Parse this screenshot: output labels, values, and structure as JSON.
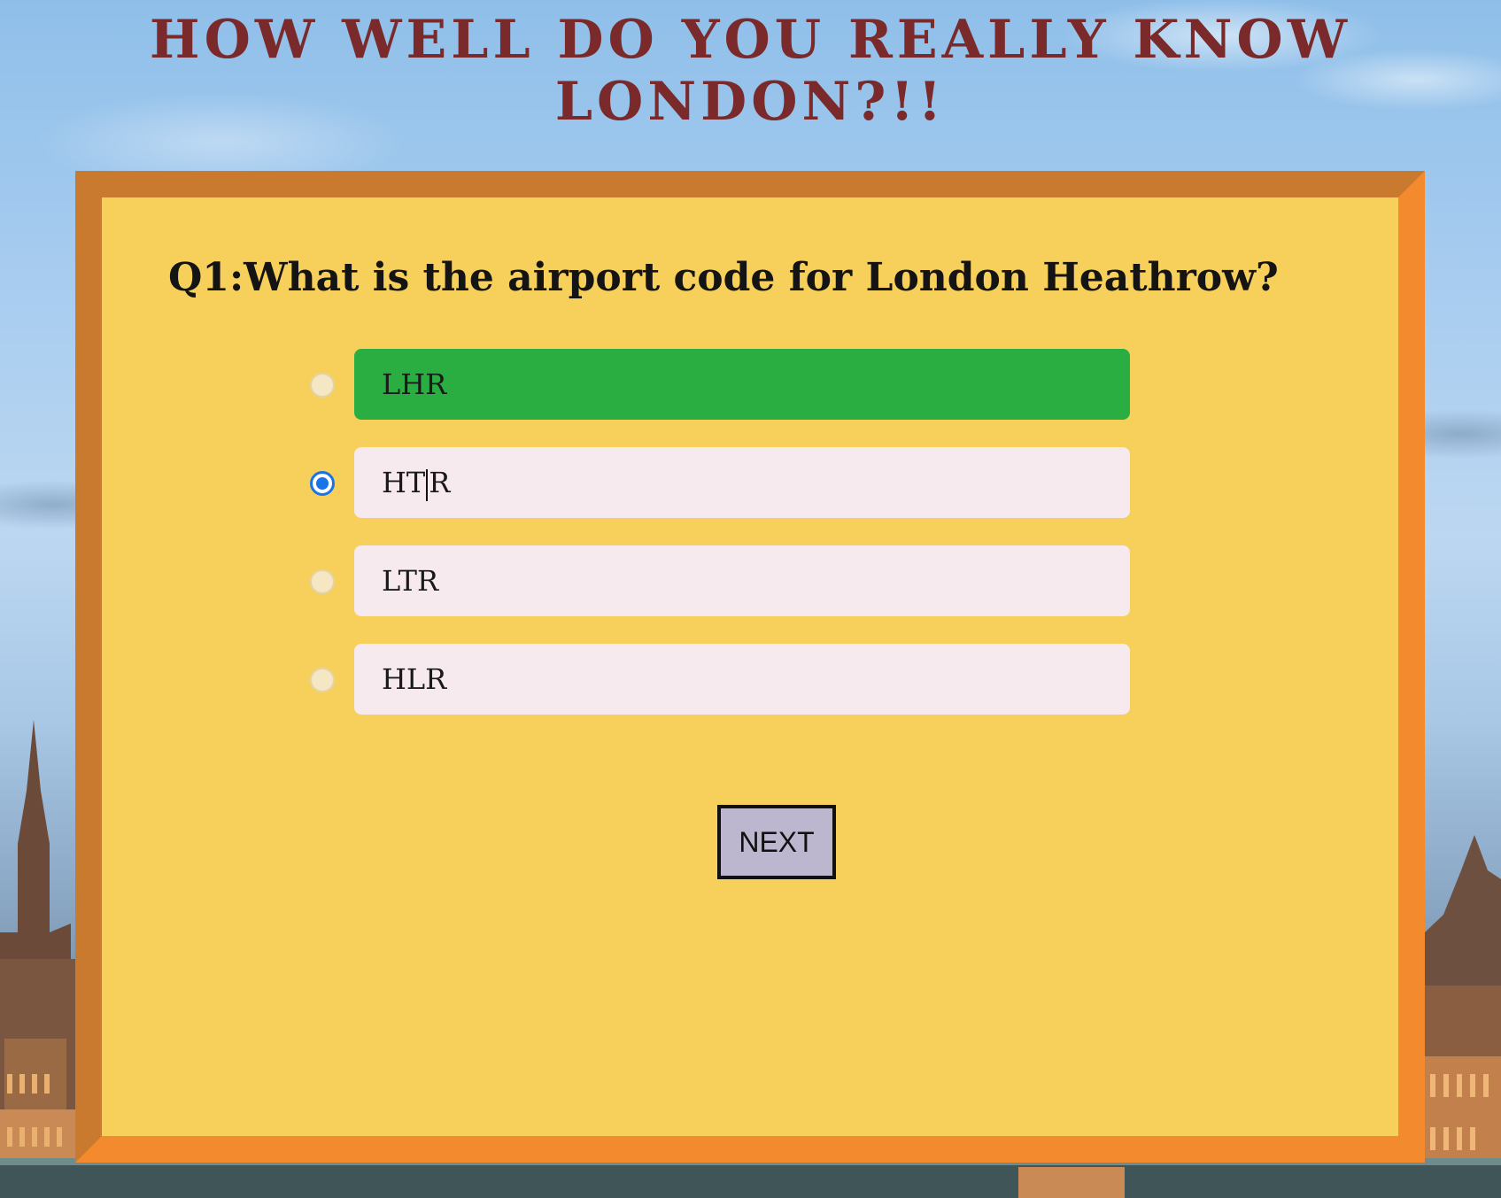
{
  "page_title": "HOW WELL DO YOU REALLY KNOW LONDON?!!",
  "quiz": {
    "question": "Q1:What is the airport code for London Heathrow?",
    "options": [
      {
        "label": "LHR",
        "state": "correct",
        "selected": false
      },
      {
        "label": "HTR",
        "state": "default",
        "selected": true
      },
      {
        "label": "LTR",
        "state": "default",
        "selected": false
      },
      {
        "label": "HLR",
        "state": "default",
        "selected": false
      }
    ],
    "next_label": "NEXT"
  },
  "colors": {
    "title": "#7a2a2a",
    "panel": "#f7cf5b",
    "frame": "#f48a2e",
    "correct": "#2aae42",
    "option_bg": "#f6eaee",
    "radio_selected": "#1a73e8",
    "next_button": "#bcb6cf"
  }
}
